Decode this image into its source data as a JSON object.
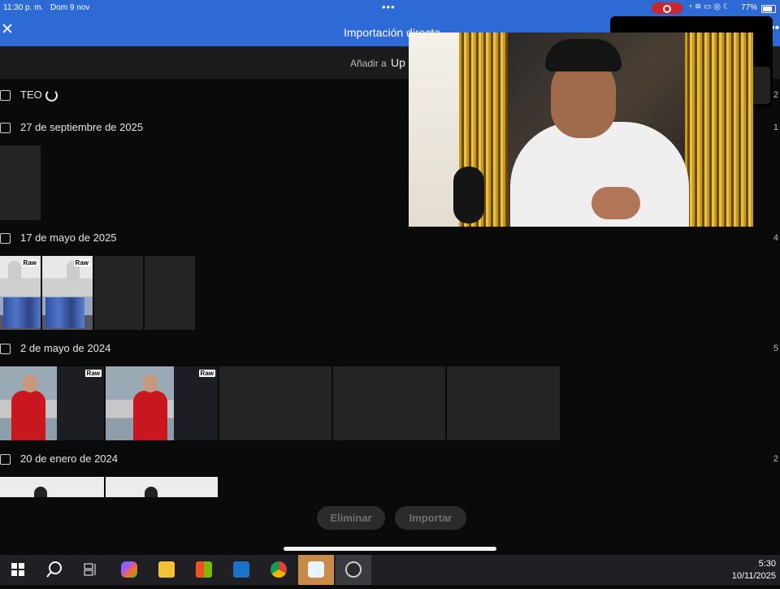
{
  "status_bar": {
    "time": "11:30 p. m.",
    "date": "Dom 9 nov",
    "dots": "•••",
    "battery": "77%"
  },
  "title_bar": {
    "close": "✕",
    "title": "Importación directa",
    "more": "•••"
  },
  "destination": {
    "label": "Añadir a",
    "value": "Up"
  },
  "groups": [
    {
      "label": "TEO",
      "count": "2"
    },
    {
      "label": "27 de septiembre de 2025",
      "count": "1"
    },
    {
      "label": "17 de mayo de 2025",
      "count": "4"
    },
    {
      "label": "2 de mayo de 2024",
      "count": "5"
    },
    {
      "label": "20 de enero de 2024",
      "count": "2"
    }
  ],
  "raw_badge": "Raw",
  "actions": {
    "delete": "Eliminar",
    "import": "Importar"
  },
  "taskbar": {
    "time": "5:30",
    "date": "10/11/2025",
    "apps": [
      "windows-start",
      "search",
      "task-view",
      "copilot",
      "file-explorer",
      "microsoft-store",
      "outlook",
      "chrome",
      "remote-app",
      "obs-studio"
    ]
  },
  "colors": {
    "accent": "#2d6ad6",
    "background": "#0a0a0a",
    "recording": "#c9262d"
  }
}
